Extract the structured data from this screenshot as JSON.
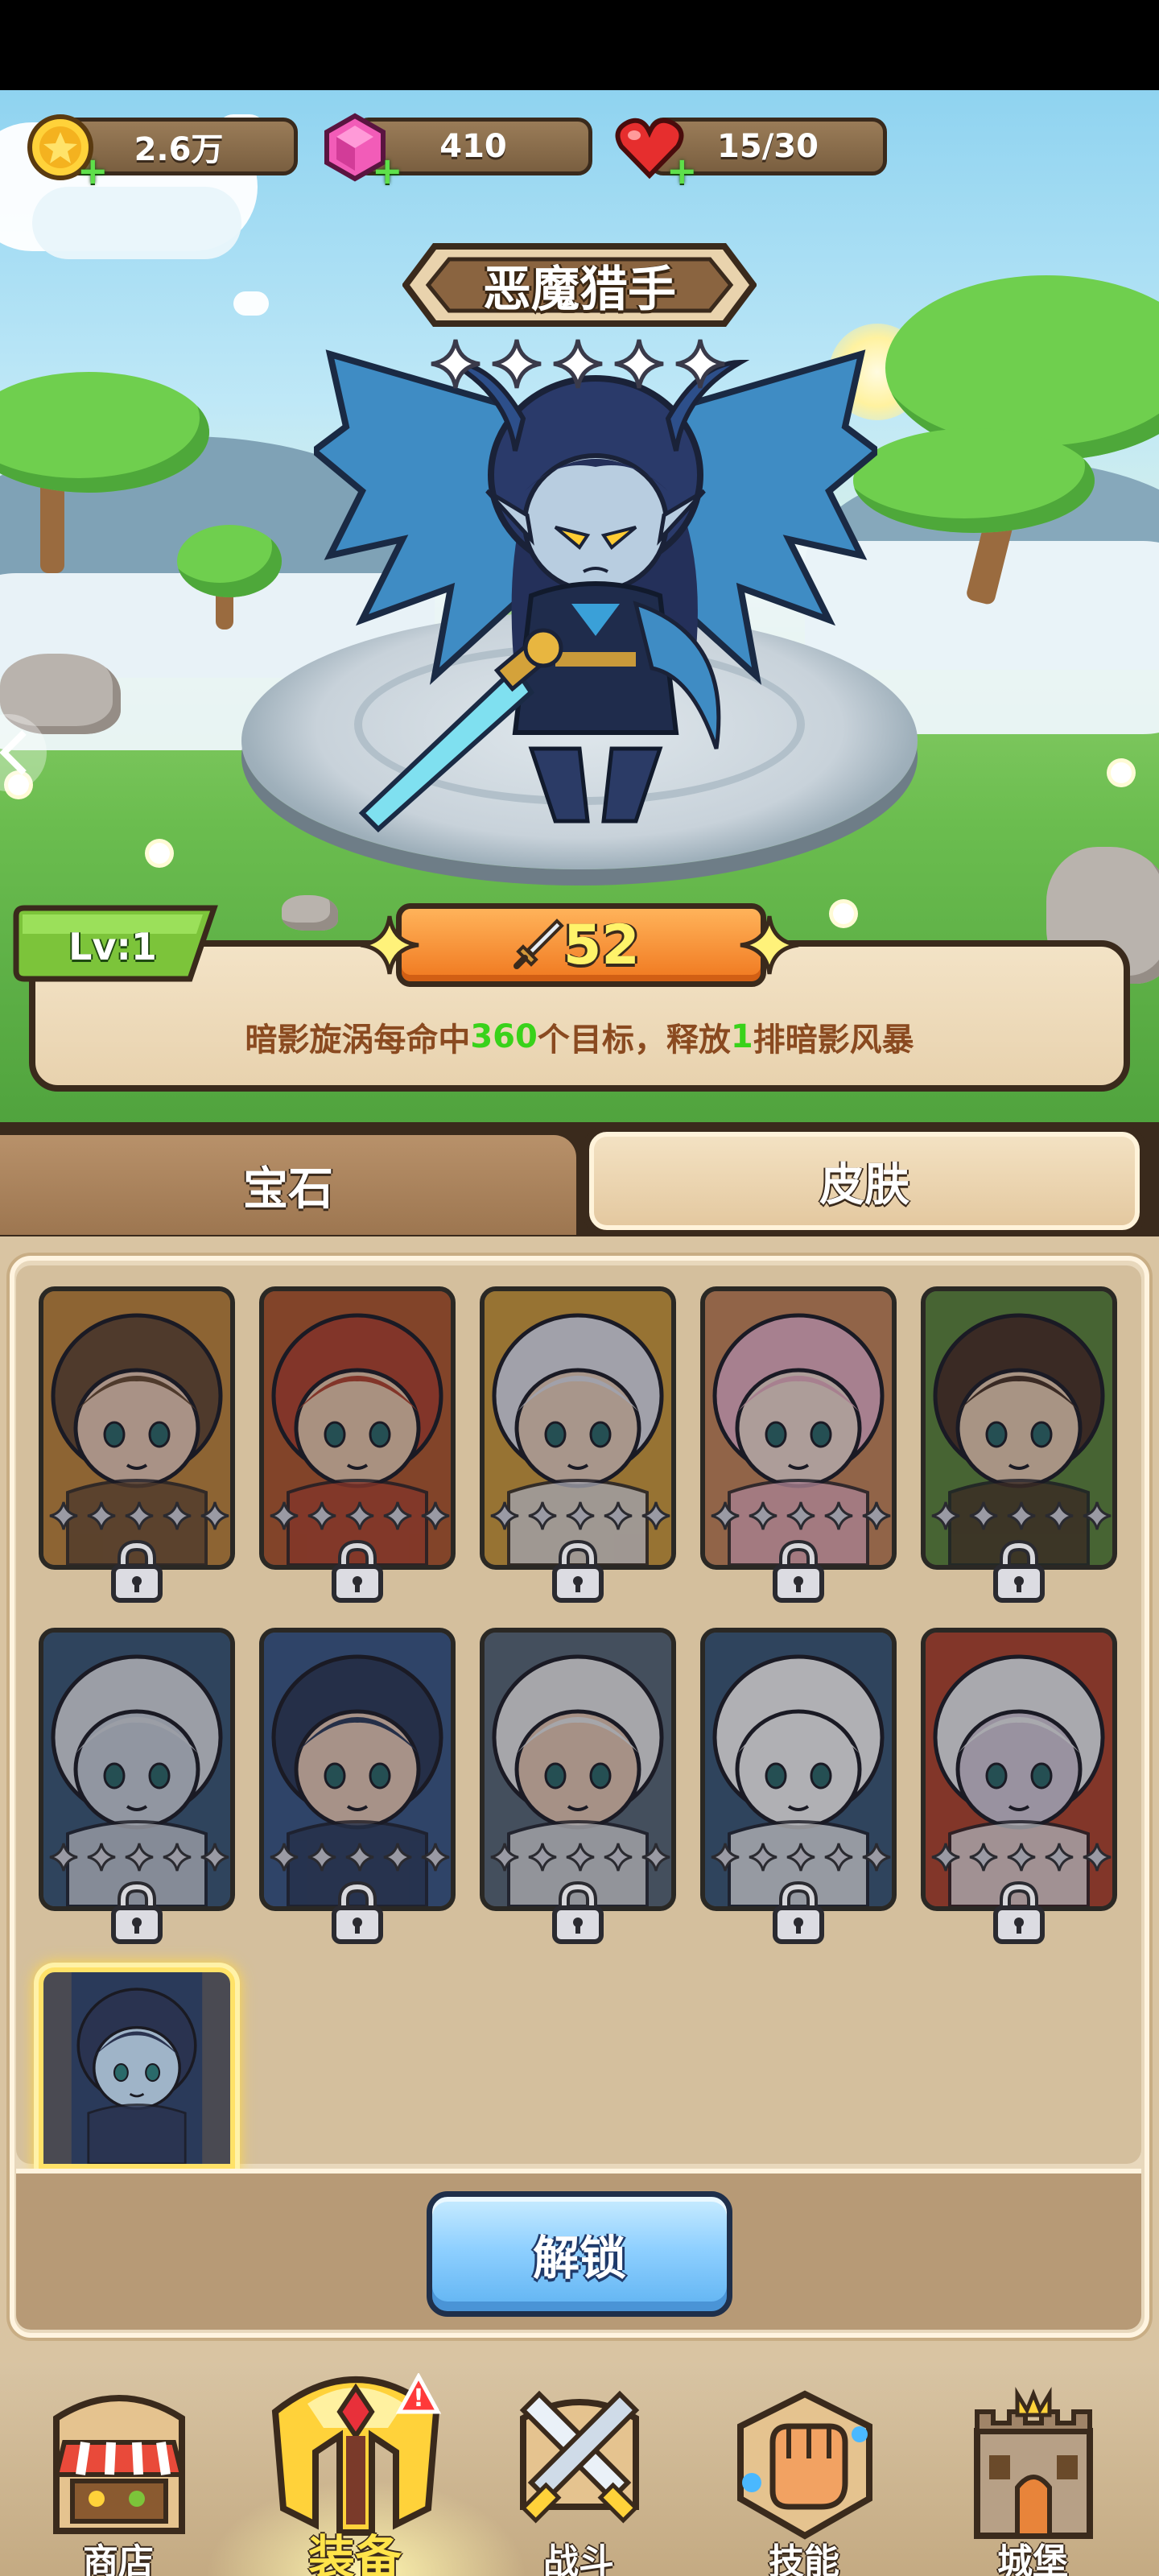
{
  "resources": {
    "gold": {
      "value": "2.6万",
      "icon": "gold-coin-icon"
    },
    "gems": {
      "value": "410",
      "icon": "pink-gem-icon"
    },
    "stamina": {
      "value": "15/30",
      "icon": "red-heart-icon"
    }
  },
  "hero": {
    "name": "恶魔猎手",
    "stars": 5,
    "level": "Lv:1",
    "power": "52",
    "description": {
      "part1": "暗影旋涡每命中",
      "num1": "360",
      "part2": "个目标，释放",
      "num2": "1",
      "part3": "排暗影风暴"
    }
  },
  "tabs": [
    {
      "label": "宝石",
      "active": false
    },
    {
      "label": "皮肤",
      "active": true
    }
  ],
  "skins": [
    {
      "hair": "#6b4a2e",
      "skin": "#f5d2b8",
      "bg": "#c98a3a",
      "locked": true
    },
    {
      "hair": "#b8432a",
      "skin": "#f5cfb0",
      "bg": "#b85a2a",
      "locked": true
    },
    {
      "hair": "#e8e8f0",
      "skin": "#f3d8c0",
      "bg": "#d9a23a",
      "locked": true
    },
    {
      "hair": "#f2b6c6",
      "skin": "#fbe2d6",
      "bg": "#d08a5a",
      "locked": true
    },
    {
      "hair": "#4a3222",
      "skin": "#f3d4b6",
      "bg": "#5f8a3a",
      "locked": true
    },
    {
      "hair": "#dfe3ea",
      "skin": "#cfd8e2",
      "bg": "#3a5a7a",
      "locked": true
    },
    {
      "hair": "#2a3a5a",
      "skin": "#f2d2bc",
      "bg": "#3a5a8a",
      "locked": true
    },
    {
      "hair": "#f0f0f0",
      "skin": "#f0d0b8",
      "bg": "#5a6a7a",
      "locked": true
    },
    {
      "hair": "#ffffff",
      "skin": "#ffffff",
      "bg": "#3a5a7a",
      "locked": true
    },
    {
      "hair": "#f4f4f6",
      "skin": "#dcd2e0",
      "bg": "#b8442a",
      "locked": true
    },
    {
      "hair": "#2a3350",
      "skin": "#9fb4c8",
      "bg": "#2a3a5a",
      "locked": false
    }
  ],
  "unlock_button": "解锁",
  "nav": [
    {
      "label": "商店",
      "icon": "shop-icon"
    },
    {
      "label": "装备",
      "icon": "equipment-helmet-icon",
      "active": true,
      "alert": "!"
    },
    {
      "label": "战斗",
      "icon": "crossed-swords-icon"
    },
    {
      "label": "技能",
      "icon": "fist-skill-icon"
    },
    {
      "label": "城堡",
      "icon": "castle-icon"
    }
  ],
  "colors": {
    "accent_gold": "#ffe268",
    "power_orange": "#f0781f",
    "highlight_green": "#39d21a",
    "button_blue": "#5fb3f2"
  }
}
